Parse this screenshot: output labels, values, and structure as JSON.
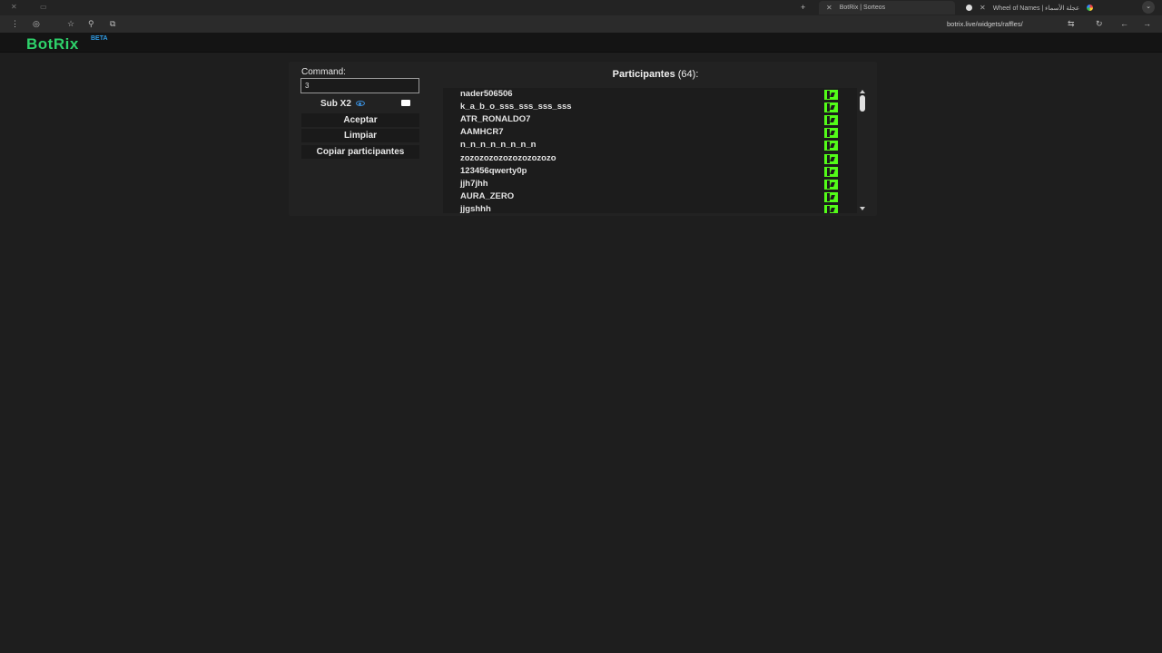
{
  "browser": {
    "tabs": [
      {
        "title": "BotRix | Sorteos",
        "active": true
      },
      {
        "title": "Wheel of Names | عجلة الأسماء",
        "active": false
      }
    ],
    "url": "botrix.live/widgets/raffles/"
  },
  "site": {
    "logo": "BotRix",
    "badge": "BETA",
    "colors": {
      "logo": "#2ed16a",
      "badge": "#2f9ce6",
      "kick": "#53fc18"
    }
  },
  "form": {
    "command_label": "Command:",
    "command_value": "3",
    "sub_label": "Sub X2",
    "accept_label": "Aceptar",
    "clear_label": "Limpiar",
    "copy_label": "Copiar participantes"
  },
  "participants": {
    "title": "Participantes",
    "count": "(64):",
    "items": [
      "nader506506",
      "k_a_b_o_sss_sss_sss_sss",
      "ATR_RONALDO7",
      "AAMHCR7",
      "n_n_n_n_n_n_n_n",
      "zozozozozozozozozozo",
      "123456qwerty0p",
      "jjh7jhh",
      "AURA_ZERO",
      "jjgshhh"
    ]
  }
}
